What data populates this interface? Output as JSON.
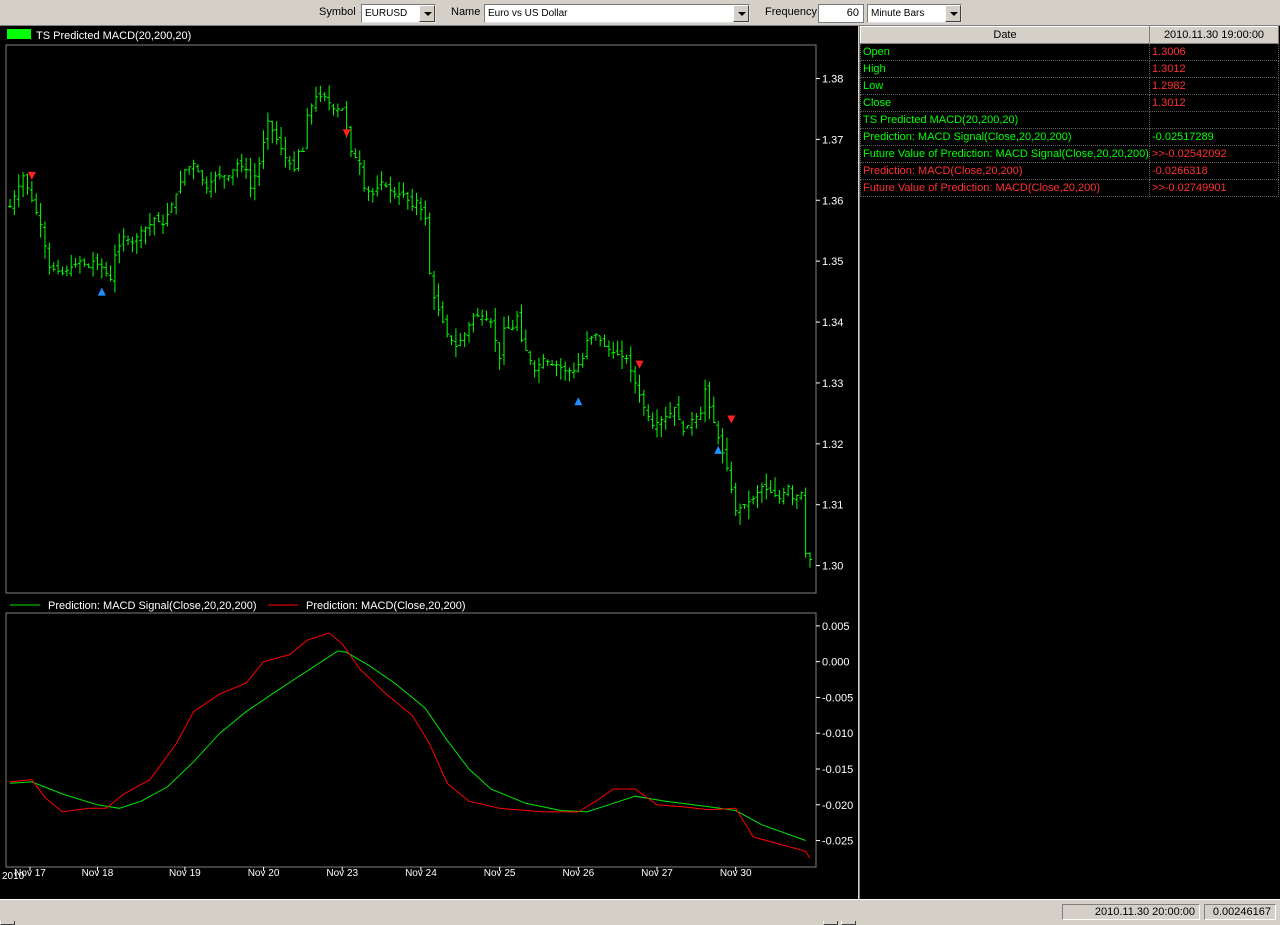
{
  "toolbar": {
    "symbol_label": "Symbol",
    "symbol_value": "EURUSD",
    "name_label": "Name",
    "name_value": "Euro vs US Dollar",
    "frequency_label": "Frequency",
    "frequency_value": "60",
    "interval_value": "Minute Bars"
  },
  "colors": {
    "price": "#00ff00",
    "signal_line": "#00e600",
    "macd_line": "#ff0000",
    "up_marker": "#1e90ff",
    "down_marker": "#ff2020",
    "panel_red": "#ff3030"
  },
  "info_table": {
    "header_label": "Date",
    "header_value": "2010.11.30 19:00:00",
    "rows": [
      {
        "label": "Open",
        "value": "1.3006",
        "color": "green",
        "vcolor": "red"
      },
      {
        "label": "High",
        "value": "1.3012",
        "color": "green",
        "vcolor": "red"
      },
      {
        "label": "Low",
        "value": "1.2982",
        "color": "green",
        "vcolor": "red"
      },
      {
        "label": "Close",
        "value": "1.3012",
        "color": "green",
        "vcolor": "red"
      },
      {
        "label": "TS Predicted MACD(20,200,20)",
        "value": "",
        "color": "green",
        "vcolor": "green"
      },
      {
        "label": "Prediction: MACD Signal(Close,20,20,200)",
        "value": "-0.02517289",
        "color": "green",
        "vcolor": "green"
      },
      {
        "label": "Future Value of Prediction: MACD Signal(Close,20,20,200)",
        "value": ">>-0.02542092",
        "color": "green",
        "vcolor": "red"
      },
      {
        "label": "Prediction: MACD(Close,20,200)",
        "value": "-0.0266318",
        "color": "red",
        "vcolor": "red"
      },
      {
        "label": "Future Value of Prediction: MACD(Close,20,200)",
        "value": ">>-0.02749901",
        "color": "red",
        "vcolor": "red"
      }
    ]
  },
  "status": {
    "datetime": "2010.11.30 20:00:00",
    "value": "0.00246167"
  },
  "chart_data": [
    {
      "type": "candlestick",
      "legend": "TS Predicted MACD(20,200,20)",
      "ylim": [
        1.2955,
        1.3855
      ],
      "yticks": [
        "1.38",
        "1.37",
        "1.36",
        "1.35",
        "1.34",
        "1.33",
        "1.32",
        "1.31",
        "1.30"
      ],
      "x_tick_labels": [
        "Nov 17",
        "Nov 18",
        "Nov 19",
        "Nov 20",
        "Nov 23",
        "Nov 24",
        "Nov 25",
        "Nov 26",
        "Nov 27",
        "Nov 30"
      ],
      "year_label": "2010",
      "close_path": [
        [
          0,
          1.359
        ],
        [
          3,
          1.364
        ],
        [
          5,
          1.36
        ],
        [
          7,
          1.356
        ],
        [
          9,
          1.349
        ],
        [
          12,
          1.348
        ],
        [
          14,
          1.349
        ],
        [
          16,
          1.35
        ],
        [
          18,
          1.349
        ],
        [
          19,
          1.35
        ],
        [
          21,
          1.349
        ],
        [
          23,
          1.347
        ],
        [
          24,
          1.351
        ],
        [
          26,
          1.354
        ],
        [
          28,
          1.353
        ],
        [
          30,
          1.355
        ],
        [
          32,
          1.356
        ],
        [
          33,
          1.357
        ],
        [
          35,
          1.356
        ],
        [
          38,
          1.361
        ],
        [
          40,
          1.365
        ],
        [
          42,
          1.366
        ],
        [
          45,
          1.362
        ],
        [
          47,
          1.364
        ],
        [
          50,
          1.364
        ],
        [
          52,
          1.366
        ],
        [
          54,
          1.365
        ],
        [
          55,
          1.362
        ],
        [
          57,
          1.366
        ],
        [
          59,
          1.373
        ],
        [
          61,
          1.37
        ],
        [
          63,
          1.367
        ],
        [
          65,
          1.365
        ],
        [
          66,
          1.368
        ],
        [
          67,
          1.368
        ],
        [
          68,
          1.374
        ],
        [
          70,
          1.377
        ],
        [
          72,
          1.377
        ],
        [
          74,
          1.375
        ],
        [
          76,
          1.375
        ],
        [
          78,
          1.368
        ],
        [
          80,
          1.366
        ],
        [
          81,
          1.362
        ],
        [
          83,
          1.361
        ],
        [
          85,
          1.363
        ],
        [
          88,
          1.361
        ],
        [
          90,
          1.361
        ],
        [
          92,
          1.359
        ],
        [
          93,
          1.36
        ],
        [
          95,
          1.357
        ],
        [
          96,
          1.348
        ],
        [
          97,
          1.344
        ],
        [
          99,
          1.34
        ],
        [
          100,
          1.338
        ],
        [
          102,
          1.336
        ],
        [
          104,
          1.338
        ],
        [
          106,
          1.341
        ],
        [
          108,
          1.341
        ],
        [
          110,
          1.34
        ],
        [
          112,
          1.334
        ],
        [
          113,
          1.339
        ],
        [
          115,
          1.339
        ],
        [
          116,
          1.341
        ],
        [
          117,
          1.337
        ],
        [
          120,
          1.332
        ],
        [
          122,
          1.334
        ],
        [
          124,
          1.333
        ],
        [
          125,
          1.333
        ],
        [
          127,
          1.332
        ],
        [
          129,
          1.332
        ],
        [
          130,
          1.333
        ],
        [
          131,
          1.334
        ],
        [
          132,
          1.337
        ],
        [
          134,
          1.338
        ],
        [
          136,
          1.336
        ],
        [
          138,
          1.335
        ],
        [
          141,
          1.334
        ],
        [
          143,
          1.33
        ],
        [
          145,
          1.326
        ],
        [
          147,
          1.323
        ],
        [
          149,
          1.324
        ],
        [
          151,
          1.325
        ],
        [
          152,
          1.326
        ],
        [
          154,
          1.322
        ],
        [
          156,
          1.324
        ],
        [
          158,
          1.325
        ],
        [
          159,
          1.329
        ],
        [
          160,
          1.326
        ],
        [
          162,
          1.321
        ],
        [
          164,
          1.316
        ],
        [
          166,
          1.309
        ],
        [
          168,
          1.31
        ],
        [
          170,
          1.311
        ],
        [
          172,
          1.313
        ],
        [
          174,
          1.312
        ],
        [
          176,
          1.311
        ],
        [
          178,
          1.313
        ],
        [
          179,
          1.311
        ],
        [
          181,
          1.312
        ],
        [
          182,
          1.302
        ],
        [
          183,
          1.301
        ]
      ],
      "n_bars": 184,
      "buy_markers": [
        [
          21,
          1.345
        ],
        [
          130,
          1.327
        ],
        [
          162,
          1.319
        ]
      ],
      "sell_markers": [
        [
          5,
          1.364
        ],
        [
          77,
          1.371
        ],
        [
          144,
          1.333
        ],
        [
          165,
          1.324
        ]
      ]
    },
    {
      "type": "line",
      "ylim": [
        -0.0287,
        0.0068
      ],
      "yticks": [
        "0.005",
        "0.000",
        "-0.005",
        "-0.010",
        "-0.015",
        "-0.020",
        "-0.025"
      ],
      "series": [
        {
          "name": "Prediction: MACD Signal(Close,20,20,200)",
          "points": [
            [
              0,
              -0.017
            ],
            [
              5,
              -0.0168
            ],
            [
              12,
              -0.0185
            ],
            [
              20,
              -0.02
            ],
            [
              25,
              -0.0205
            ],
            [
              30,
              -0.0195
            ],
            [
              36,
              -0.0175
            ],
            [
              42,
              -0.014
            ],
            [
              48,
              -0.01
            ],
            [
              54,
              -0.007
            ],
            [
              60,
              -0.0045
            ],
            [
              65,
              -0.0025
            ],
            [
              70,
              -0.0005
            ],
            [
              75,
              0.0015
            ],
            [
              77,
              0.0013
            ],
            [
              82,
              -0.0005
            ],
            [
              88,
              -0.003
            ],
            [
              95,
              -0.0065
            ],
            [
              100,
              -0.011
            ],
            [
              105,
              -0.015
            ],
            [
              110,
              -0.0178
            ],
            [
              118,
              -0.0198
            ],
            [
              126,
              -0.0208
            ],
            [
              132,
              -0.021
            ],
            [
              138,
              -0.0198
            ],
            [
              143,
              -0.0188
            ],
            [
              150,
              -0.0195
            ],
            [
              160,
              -0.0203
            ],
            [
              166,
              -0.0208
            ],
            [
              172,
              -0.0228
            ],
            [
              182,
              -0.025
            ]
          ]
        },
        {
          "name": "Prediction: MACD(Close,20,200)",
          "points": [
            [
              0,
              -0.0168
            ],
            [
              5,
              -0.0165
            ],
            [
              8,
              -0.019
            ],
            [
              12,
              -0.021
            ],
            [
              18,
              -0.0205
            ],
            [
              22,
              -0.0205
            ],
            [
              26,
              -0.0185
            ],
            [
              32,
              -0.0165
            ],
            [
              38,
              -0.0115
            ],
            [
              42,
              -0.007
            ],
            [
              48,
              -0.0045
            ],
            [
              54,
              -0.003
            ],
            [
              58,
              0.0
            ],
            [
              64,
              0.001
            ],
            [
              68,
              0.003
            ],
            [
              73,
              0.004
            ],
            [
              76,
              0.0025
            ],
            [
              80,
              -0.001
            ],
            [
              86,
              -0.0045
            ],
            [
              92,
              -0.0075
            ],
            [
              96,
              -0.0115
            ],
            [
              100,
              -0.017
            ],
            [
              105,
              -0.0195
            ],
            [
              112,
              -0.0205
            ],
            [
              122,
              -0.021
            ],
            [
              130,
              -0.021
            ],
            [
              134,
              -0.0195
            ],
            [
              138,
              -0.0178
            ],
            [
              143,
              -0.0178
            ],
            [
              148,
              -0.02
            ],
            [
              154,
              -0.0203
            ],
            [
              160,
              -0.0207
            ],
            [
              166,
              -0.0205
            ],
            [
              170,
              -0.0245
            ],
            [
              176,
              -0.0255
            ],
            [
              182,
              -0.0265
            ],
            [
              183,
              -0.0275
            ]
          ]
        }
      ]
    }
  ]
}
